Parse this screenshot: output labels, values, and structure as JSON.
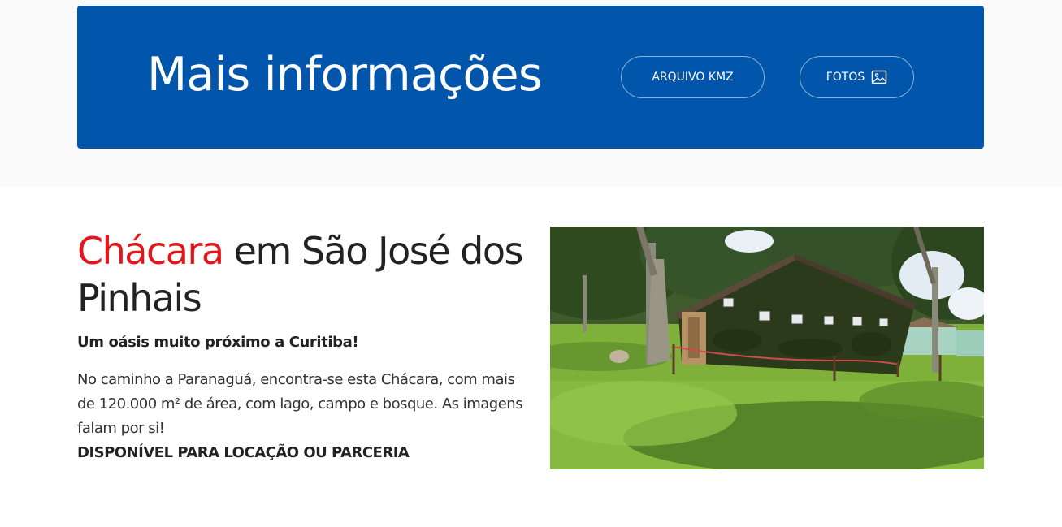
{
  "banner": {
    "title": "Mais informações",
    "kmz_button": "ARQUIVO KMZ",
    "photos_button": "FOTOS",
    "photos_icon": "image-icon",
    "background_color": "#0156ac"
  },
  "hero": {
    "heading_accent": "Chácara",
    "heading_rest": " em São José dos Pinhais",
    "accent_color": "#e0181b",
    "subheading": "Um oásis muito próximo a Curitiba!",
    "description": "No caminho a Paranaguá, encontra-se esta Chácara, com mais de 120.000 m² de área, com lago, campo e bosque. As imagens falam por si!",
    "availability": "DISPONÍVEL PARA LOCAÇÃO OU PARCERIA"
  },
  "photo": {
    "subject": "ivy-covered house on lawn among trees"
  }
}
